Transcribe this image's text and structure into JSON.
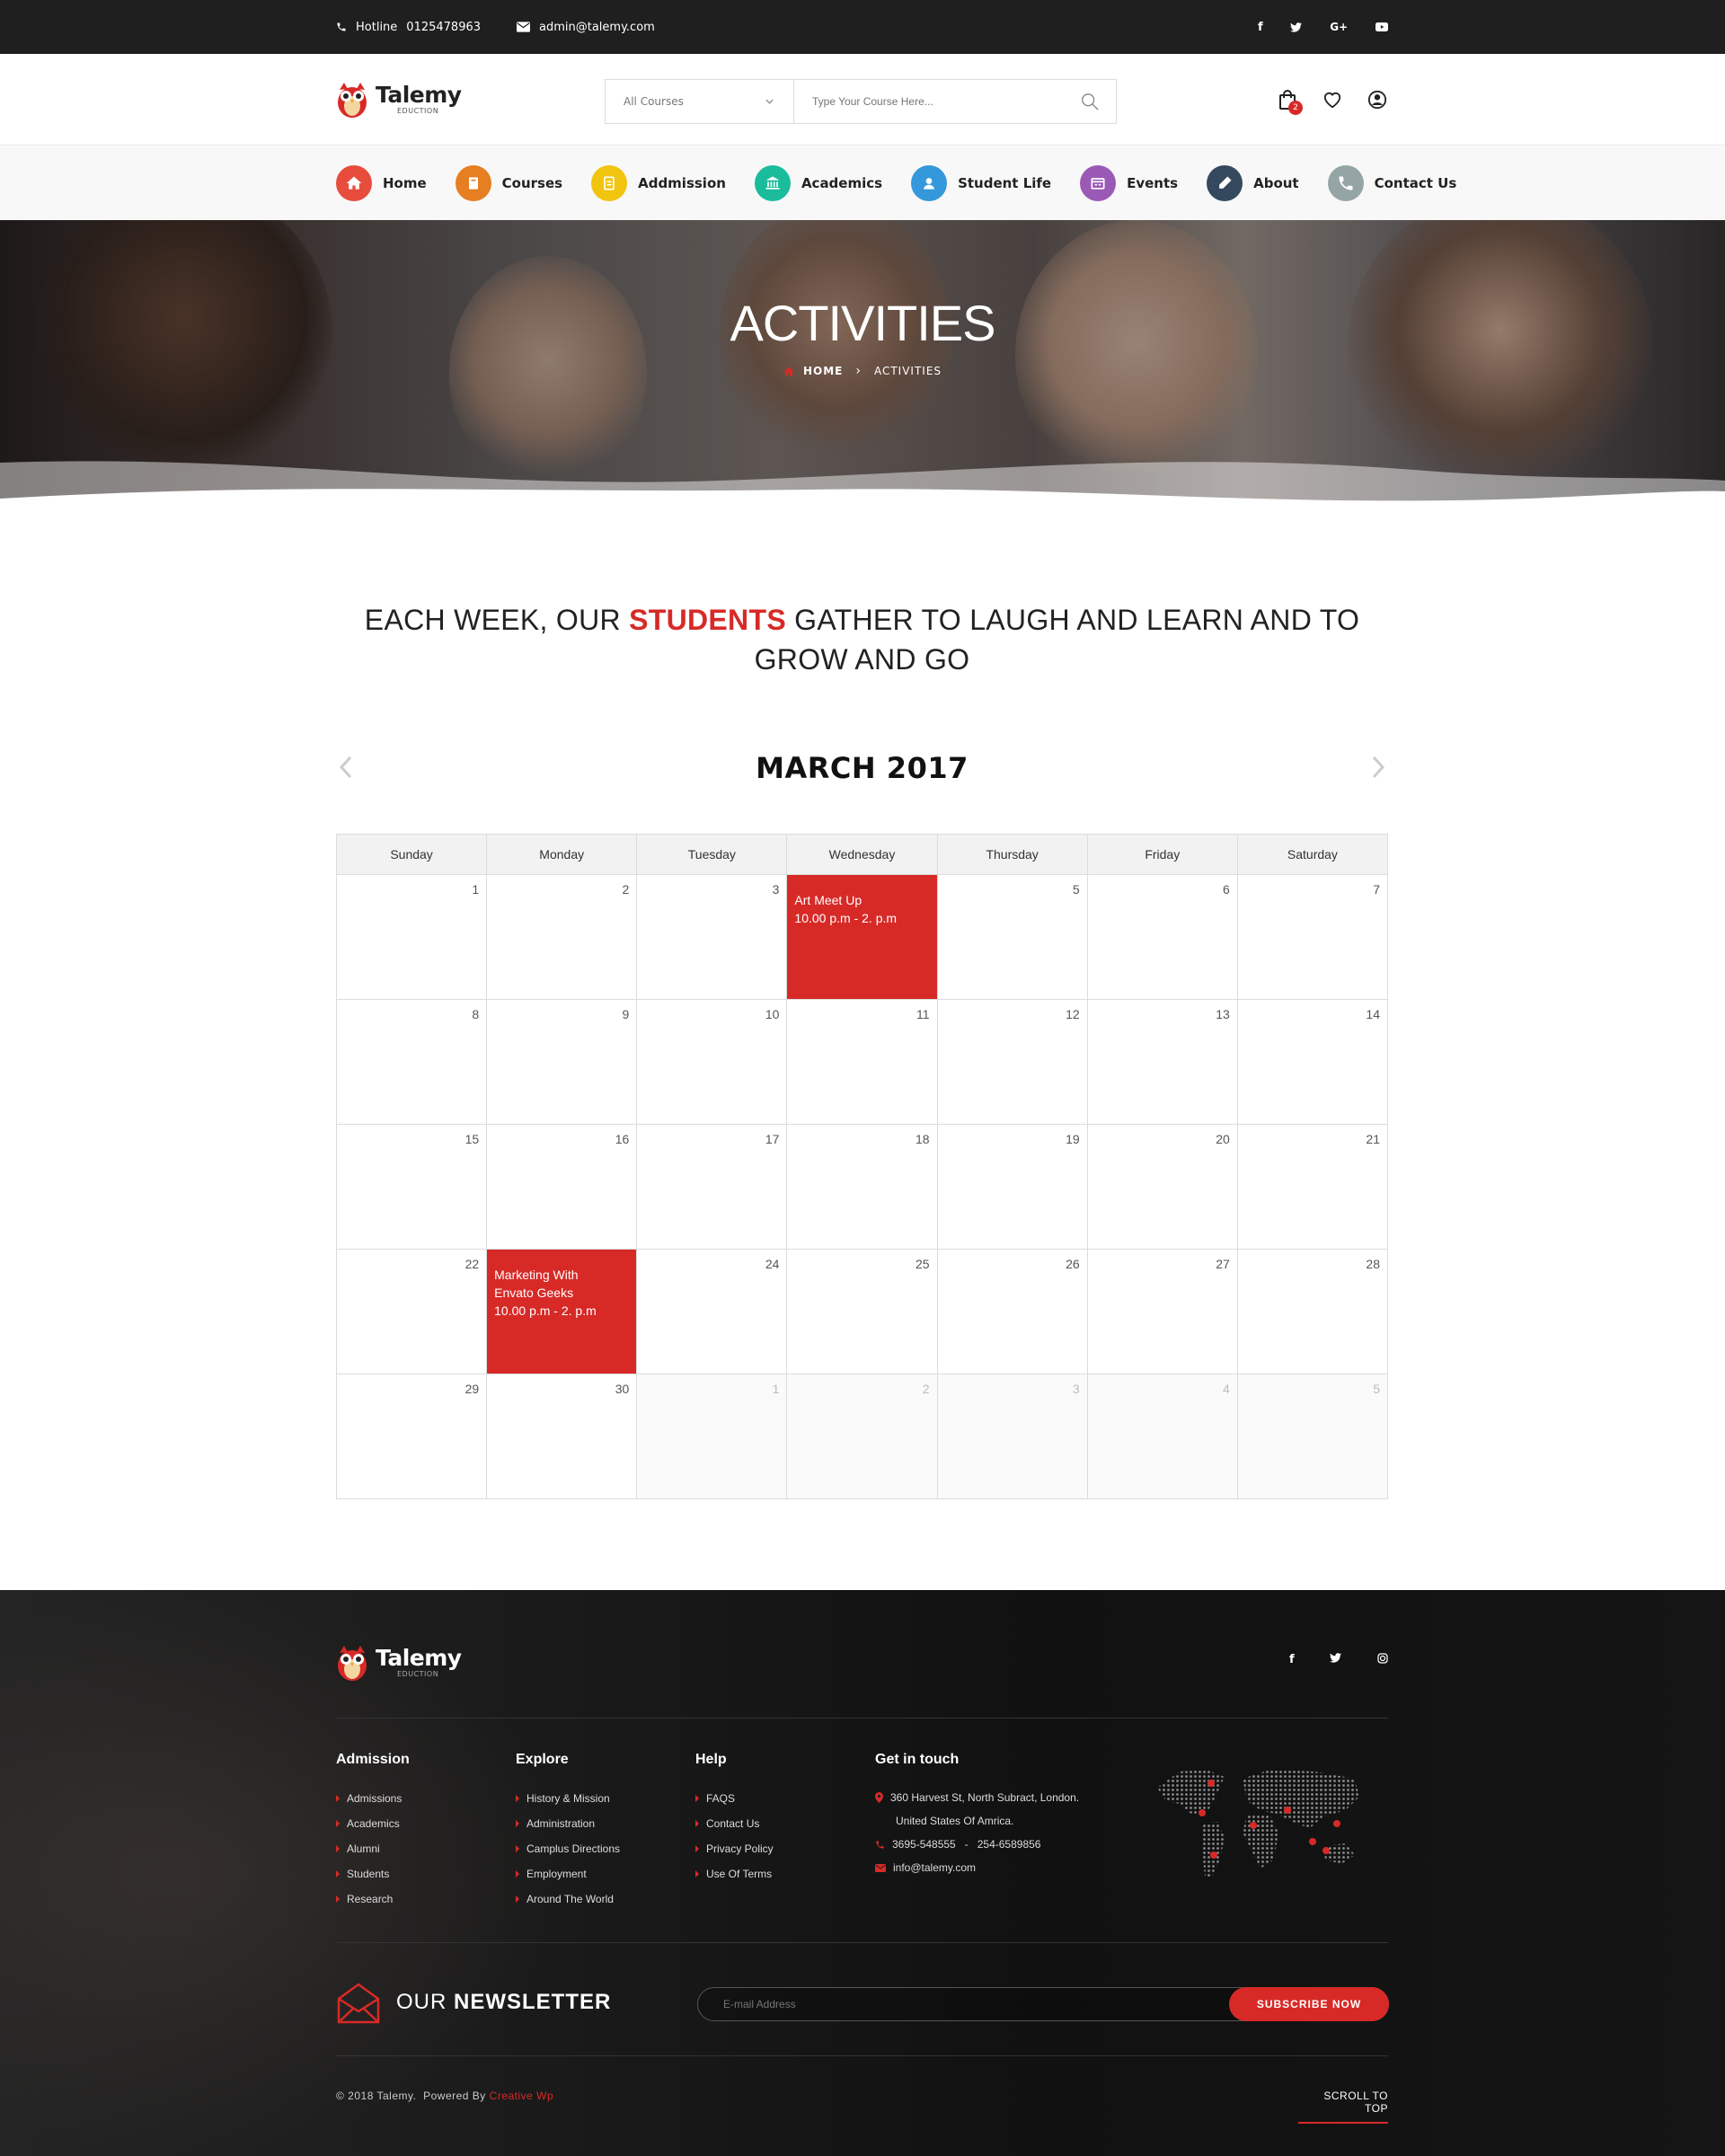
{
  "topbar": {
    "hotline_label": "Hotline",
    "hotline_number": "0125478963",
    "email": "admin@talemy.com",
    "social": [
      "f",
      "t",
      "G+",
      "yt"
    ]
  },
  "brand": {
    "name": "Talemy",
    "tagline": "EDUCTION",
    "accent": "#d72a27"
  },
  "search": {
    "category": "All Courses",
    "placeholder": "Type Your Course Here...",
    "input_value": ""
  },
  "header_icons": {
    "cart_count": "2"
  },
  "nav": {
    "items": [
      {
        "label": "Home",
        "icon": "home-icon",
        "color": "#e74c3c"
      },
      {
        "label": "Courses",
        "icon": "book-icon",
        "color": "#e67e22"
      },
      {
        "label": "Addmission",
        "icon": "clipboard-icon",
        "color": "#f1c40f"
      },
      {
        "label": "Academics",
        "icon": "bank-icon",
        "color": "#1abc9c"
      },
      {
        "label": "Student Life",
        "icon": "user-icon",
        "color": "#3498db"
      },
      {
        "label": "Events",
        "icon": "calendar-icon",
        "color": "#9b59b6"
      },
      {
        "label": "About",
        "icon": "pen-icon",
        "color": "#34495e"
      },
      {
        "label": "Contact Us",
        "icon": "phone-icon",
        "color": "#95a5a6"
      }
    ]
  },
  "hero": {
    "title": "ACTIVITIES",
    "breadcrumb_home": "HOME",
    "breadcrumb_current": "ACTIVITIES"
  },
  "intro": {
    "before": "EACH WEEK, OUR ",
    "highlight": "STUDENTS",
    "after": " GATHER TO LAUGH AND LEARN AND TO GROW AND GO"
  },
  "calendar": {
    "month": "MARCH 2017",
    "weekdays": [
      "Sunday",
      "Monday",
      "Tuesday",
      "Wednesday",
      "Thursday",
      "Friday",
      "Saturday"
    ],
    "weeks": [
      [
        {
          "d": "1"
        },
        {
          "d": "2"
        },
        {
          "d": "3"
        },
        {
          "d": "",
          "event": [
            "Art Meet Up",
            "10.00 p.m - 2. p.m"
          ]
        },
        {
          "d": "5"
        },
        {
          "d": "6"
        },
        {
          "d": "7"
        }
      ],
      [
        {
          "d": "8"
        },
        {
          "d": "9"
        },
        {
          "d": "10"
        },
        {
          "d": "11"
        },
        {
          "d": "12"
        },
        {
          "d": "13"
        },
        {
          "d": "14"
        }
      ],
      [
        {
          "d": "15"
        },
        {
          "d": "16"
        },
        {
          "d": "17"
        },
        {
          "d": "18"
        },
        {
          "d": "19"
        },
        {
          "d": "20"
        },
        {
          "d": "21"
        }
      ],
      [
        {
          "d": "22"
        },
        {
          "d": "",
          "event": [
            "Marketing With",
            "Envato Geeks",
            "10.00 p.m - 2. p.m"
          ]
        },
        {
          "d": "24"
        },
        {
          "d": "25"
        },
        {
          "d": "26"
        },
        {
          "d": "27"
        },
        {
          "d": "28"
        }
      ],
      [
        {
          "d": "29"
        },
        {
          "d": "30"
        },
        {
          "d": "1",
          "other": true
        },
        {
          "d": "2",
          "other": true
        },
        {
          "d": "3",
          "other": true
        },
        {
          "d": "4",
          "other": true
        },
        {
          "d": "5",
          "other": true
        }
      ]
    ]
  },
  "footer": {
    "social": [
      "f",
      "t",
      "ig"
    ],
    "columns": [
      {
        "title": "Admission",
        "links": [
          "Admissions",
          "Academics",
          "Alumni",
          "Students",
          "Research"
        ]
      },
      {
        "title": "Explore",
        "links": [
          "History & Mission",
          "Administration",
          "Camplus Directions",
          "Employment",
          "Around The World"
        ]
      },
      {
        "title": "Help",
        "links": [
          "FAQS",
          "Contact Us",
          "Privacy Policy",
          "Use Of Terms"
        ]
      }
    ],
    "contact": {
      "title": "Get in touch",
      "address1": "360 Harvest St, North Subract, London.",
      "address2": "United States Of Amrica.",
      "phone": "3695-548555   -   254-6589856",
      "email": "info@talemy.com"
    },
    "newsletter": {
      "title_light": "OUR ",
      "title_bold": "NEWSLETTER",
      "placeholder": "E-mail Address",
      "button": "SUBSCRIBE NOW"
    },
    "copyright": "© 2018 Talemy.  Powered By ",
    "powered_by": "Creative Wp",
    "scroll_top": "SCROLL TO TOP"
  }
}
